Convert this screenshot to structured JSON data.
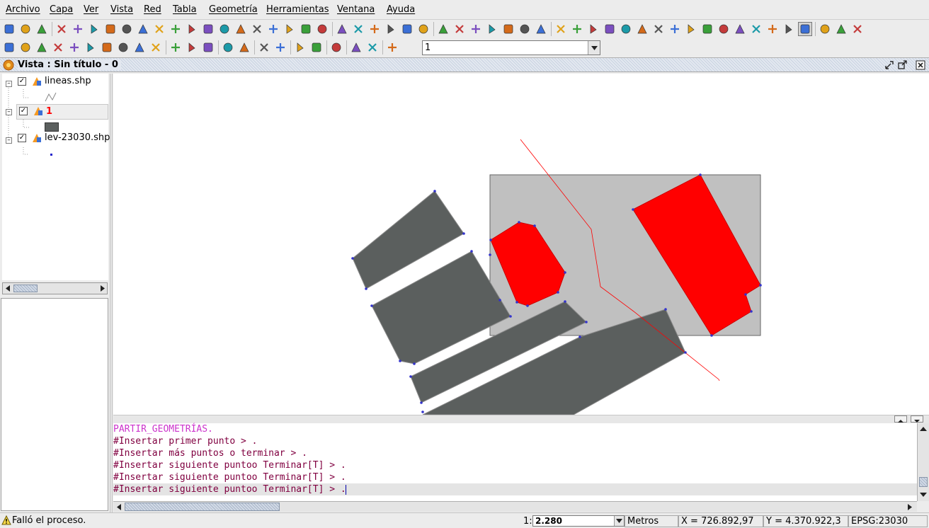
{
  "menu": [
    "Archivo",
    "Capa",
    "Ver",
    "Vista",
    "Red",
    "Tabla",
    "Geometría",
    "Herramientas",
    "Ventana",
    "Ayuda"
  ],
  "toolbar": {
    "row1_icons": [
      "new-icon",
      "open-icon",
      "save-icon",
      "add-layer-icon",
      "layer-manager-icon",
      "settings-icon",
      "export-icon",
      "edit-icon",
      "target-icon",
      "edit-note-icon",
      "tree-icon",
      "zoom-in-icon",
      "zoom-icon",
      "zoom-out-icon",
      "layers-icon",
      "zoom-extent-icon",
      "zoom-selection-icon",
      "pan-back-icon",
      "layers-color-icon",
      "hand-pan-icon",
      "info-icon",
      "add-point-icon",
      "measure-icon",
      "measure-area-icon",
      "globe-icon",
      "comment-icon",
      "select-arrow-icon",
      "select-point-icon",
      "select-multi-icon",
      "select-rect-icon",
      "select-polygon-icon",
      "select-circle-icon",
      "select-buffer-icon",
      "filter-icon",
      "hyperlink-icon",
      "hyperlink2-icon",
      "symmetry-icon",
      "rotate-icon",
      "scale-icon",
      "copy-icon",
      "move-icon",
      "explode-icon",
      "edit-vertex-icon",
      "cube-icon",
      "select-green-icon",
      "matrix-icon",
      "hammer-icon",
      "book-icon",
      "cut-icon",
      "table-icon",
      "grid-icon",
      "tools-icon"
    ],
    "row2_icons": [
      "point-icon",
      "multipoint-icon",
      "line-icon",
      "arc-icon",
      "polyline-icon",
      "circle-icon",
      "rectangle-icon",
      "ellipse-icon",
      "ellipse2-icon",
      "polygon-icon",
      "table-icon",
      "color-icon",
      "paste-icon",
      "undo-icon",
      "redo-icon",
      "find-icon",
      "zoom-find-icon",
      "check-icon",
      "map-icon",
      "magnify-icon",
      "refresh-icon",
      "layers-2-icon",
      "edit-layer-icon"
    ],
    "layer_combo_value": "1"
  },
  "view": {
    "title": "Vista : Sin título - 0"
  },
  "toc": {
    "layers": [
      {
        "name": "lineas.shp",
        "checked": true,
        "color": "#000000"
      },
      {
        "name": "1",
        "checked": true,
        "color": "#ff0000"
      },
      {
        "name": "lev-23030.shp",
        "checked": true,
        "color": "#000000"
      }
    ]
  },
  "colors": {
    "accent": "#ff0000",
    "polygon_fill": "#5b5f5e",
    "selection_fill": "#c0c0c0",
    "vertex": "#3333cc",
    "console_command": "#cc33cc",
    "console_prompt": "#800040"
  },
  "console": {
    "lines": [
      "PARTIR_GEOMETRÍAS.",
      "#Insertar primer punto > .",
      "#Insertar más puntos o terminar > .",
      "#Insertar siguiente puntoo Terminar[T] > .",
      "#Insertar siguiente puntoo Terminar[T] > .",
      "#Insertar siguiente puntoo Terminar[T] > ."
    ]
  },
  "status": {
    "message": "Falló el proceso.",
    "scale_prefix": "1:",
    "scale_value": "2.280",
    "units": "Metros",
    "x": "X = 726.892,97",
    "y": "Y = 4.370.922,3",
    "epsg": "EPSG:23030"
  }
}
